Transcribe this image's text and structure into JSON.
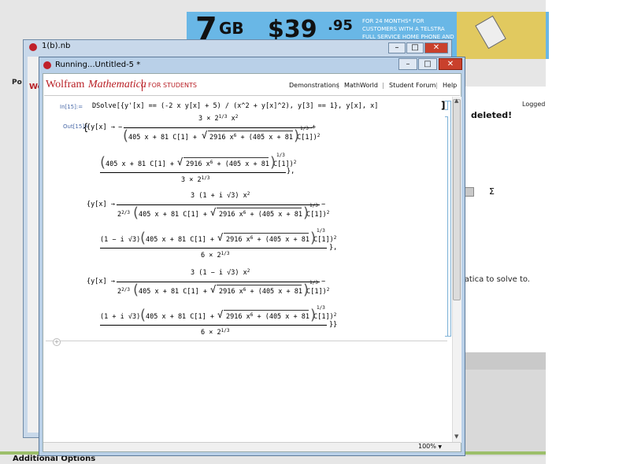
{
  "ad": {
    "data_big": "7",
    "data_unit": "GB",
    "price": "$39",
    "price_cents": ".95",
    "copy": "FOR 24 MONTHS* FOR CUSTOMERS WITH A TELSTRA FULL SERVICE HOME PHONE AND ONE OTHER"
  },
  "background": {
    "logged": "Logged",
    "deleted": "deleted!",
    "solve_text": "matica to solve to.",
    "bottom_heading": "Additional Options",
    "wolfram_trunc": "Wolfr",
    "po": "Po"
  },
  "back_window": {
    "title": "1(b).nb",
    "min": "–",
    "max": "□",
    "close": "✕"
  },
  "front_window": {
    "title": "Running...Untitled-5 *",
    "min": "–",
    "max": "□",
    "close": "✕"
  },
  "toolbar": {
    "logo_wolfram": "Wolfram",
    "logo_math": "Mathematica",
    "for_students": "FOR STUDENTS",
    "links": [
      "Demonstrations",
      "MathWorld",
      "Student Forum",
      "Help"
    ]
  },
  "notebook": {
    "in_label": "In[15]:=",
    "input": "DSolve[{y'[x] == (-2 x y[x] + 5) / (x^2 + y[x]^2), y[3] == 1}, y[x], x]",
    "out_label": "Out[15]=",
    "yx_arrow": "{y[x] →",
    "sol1_num": "3 × 2",
    "sol1_num_exp": "1/3",
    "x2": "x",
    "x2_exp": "2",
    "common_inner": "405 x + 81 C[1] +",
    "sqrt_inner": "2916 x",
    "sqrt_inner_exp": "6",
    "sqrt_tail": "+ (405 x + 81 C[1])",
    "sqrt_tail_exp": "2",
    "outer_exp": "1/3",
    "sol1_den2": "3 × 2",
    "sol1_den2_exp": "1/3",
    "sol23_num": "3",
    "one_pm_i": "1 + i",
    "one_mm_i": "1 − i",
    "sqrt3": "3",
    "sol23_den": "2",
    "sol23_den_exp": "2/3",
    "sixden": "6 × 2",
    "sixden_exp": "1/3"
  },
  "status": {
    "zoom": "100%"
  }
}
